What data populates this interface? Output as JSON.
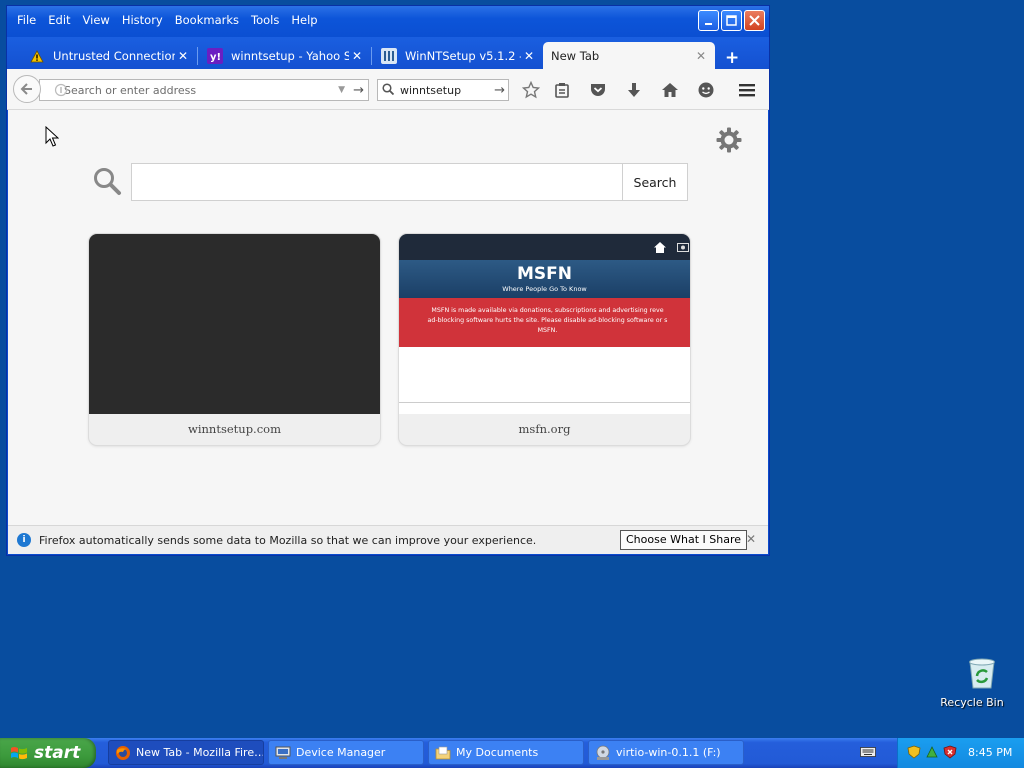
{
  "menu": [
    "File",
    "Edit",
    "View",
    "History",
    "Bookmarks",
    "Tools",
    "Help"
  ],
  "tabs": [
    {
      "label": "Untrusted Connection",
      "icon": "warning-icon"
    },
    {
      "label": "winntsetup - Yahoo S…",
      "icon": "yahoo-icon"
    },
    {
      "label": "WinNTSetup v5.1.2 - …",
      "icon": "msfn-icon"
    },
    {
      "label": "New Tab",
      "icon": "none",
      "active": true
    }
  ],
  "address": {
    "placeholder": "Search or enter address",
    "value": ""
  },
  "search_box": {
    "value": "winntsetup"
  },
  "newtab": {
    "search_button": "Search",
    "tiles": [
      {
        "label": "winntsetup.com"
      },
      {
        "label": "msfn.org"
      }
    ],
    "msfn_thumb": {
      "logo": "MSFN",
      "tagline": "Where People Go To Know",
      "banner_line1": "MSFN is made available via donations, subscriptions and advertising reve",
      "banner_line2": "ad-blocking software hurts the site. Please disable ad-blocking software or s",
      "banner_line3": "MSFN."
    }
  },
  "notification": {
    "message": "Firefox automatically sends some data to Mozilla so that we can improve your experience.",
    "button": "Choose What I Share"
  },
  "desktop": {
    "recycle_bin": "Recycle Bin"
  },
  "taskbar": {
    "start": "start",
    "tasks": [
      {
        "label": "New Tab - Mozilla Fire…",
        "active": true
      },
      {
        "label": "Device Manager"
      },
      {
        "label": "My Documents"
      },
      {
        "label": "virtio-win-0.1.1 (F:)"
      }
    ],
    "clock": "8:45 PM"
  },
  "colors": {
    "desktop": "#084d9f",
    "window_frame": "#0a4ccc",
    "taskbar": "#245edb",
    "start": "#3c9a3c",
    "tray": "#1389e0"
  }
}
